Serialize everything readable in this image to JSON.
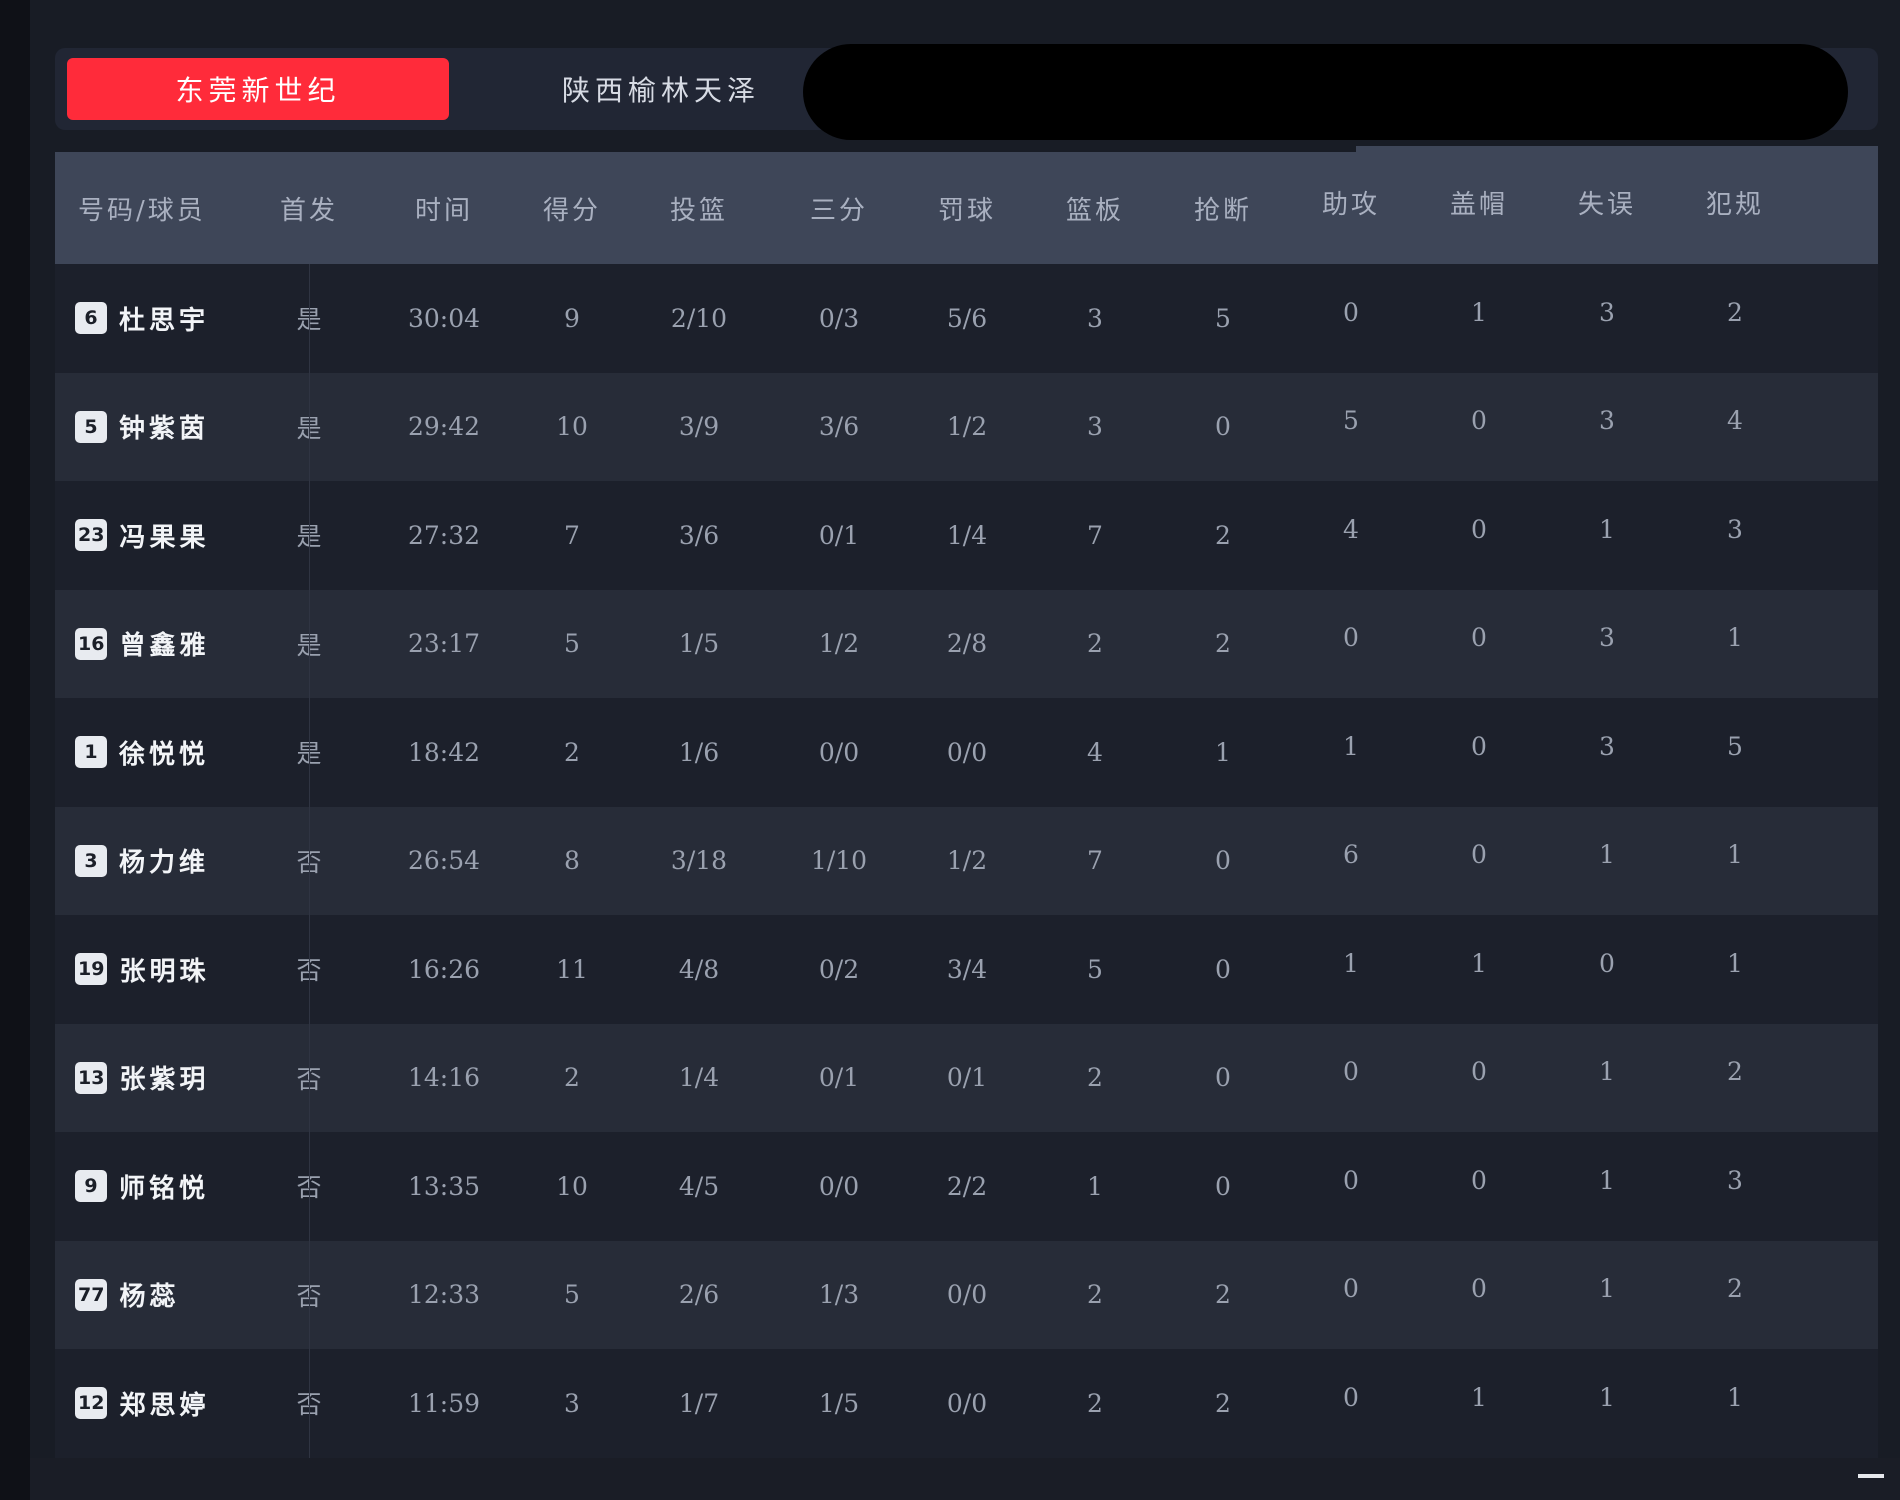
{
  "tabs": [
    {
      "label": "东莞新世纪",
      "active": true
    },
    {
      "label": "陕西榆林天泽",
      "active": false
    }
  ],
  "colors": {
    "accent": "#ff2b3a",
    "header_bg": "#3e4658",
    "row_dark": "#1c202b",
    "row_light": "#272c38"
  },
  "table": {
    "headers": [
      "号码/球员",
      "首发",
      "时间",
      "得分",
      "投篮",
      "三分",
      "罚球",
      "篮板",
      "抢断",
      "助攻",
      "盖帽",
      "失误",
      "犯规"
    ],
    "rows": [
      {
        "number": "6",
        "name": "杜思宇",
        "starter": "是",
        "time": "30:04",
        "pts": "9",
        "fg": "2/10",
        "three": "0/3",
        "ft": "5/6",
        "reb": "3",
        "stl": "5",
        "ast": "0",
        "blk": "1",
        "tov": "3",
        "pf": "2"
      },
      {
        "number": "5",
        "name": "钟紫茵",
        "starter": "是",
        "time": "29:42",
        "pts": "10",
        "fg": "3/9",
        "three": "3/6",
        "ft": "1/2",
        "reb": "3",
        "stl": "0",
        "ast": "5",
        "blk": "0",
        "tov": "3",
        "pf": "4"
      },
      {
        "number": "23",
        "name": "冯果果",
        "starter": "是",
        "time": "27:32",
        "pts": "7",
        "fg": "3/6",
        "three": "0/1",
        "ft": "1/4",
        "reb": "7",
        "stl": "2",
        "ast": "4",
        "blk": "0",
        "tov": "1",
        "pf": "3"
      },
      {
        "number": "16",
        "name": "曾鑫雅",
        "starter": "是",
        "time": "23:17",
        "pts": "5",
        "fg": "1/5",
        "three": "1/2",
        "ft": "2/8",
        "reb": "2",
        "stl": "2",
        "ast": "0",
        "blk": "0",
        "tov": "3",
        "pf": "1"
      },
      {
        "number": "1",
        "name": "徐悦悦",
        "starter": "是",
        "time": "18:42",
        "pts": "2",
        "fg": "1/6",
        "three": "0/0",
        "ft": "0/0",
        "reb": "4",
        "stl": "1",
        "ast": "1",
        "blk": "0",
        "tov": "3",
        "pf": "5"
      },
      {
        "number": "3",
        "name": "杨力维",
        "starter": "否",
        "time": "26:54",
        "pts": "8",
        "fg": "3/18",
        "three": "1/10",
        "ft": "1/2",
        "reb": "7",
        "stl": "0",
        "ast": "6",
        "blk": "0",
        "tov": "1",
        "pf": "1"
      },
      {
        "number": "19",
        "name": "张明珠",
        "starter": "否",
        "time": "16:26",
        "pts": "11",
        "fg": "4/8",
        "three": "0/2",
        "ft": "3/4",
        "reb": "5",
        "stl": "0",
        "ast": "1",
        "blk": "1",
        "tov": "0",
        "pf": "1"
      },
      {
        "number": "13",
        "name": "张紫玥",
        "starter": "否",
        "time": "14:16",
        "pts": "2",
        "fg": "1/4",
        "three": "0/1",
        "ft": "0/1",
        "reb": "2",
        "stl": "0",
        "ast": "0",
        "blk": "0",
        "tov": "1",
        "pf": "2"
      },
      {
        "number": "9",
        "name": "师铭悦",
        "starter": "否",
        "time": "13:35",
        "pts": "10",
        "fg": "4/5",
        "three": "0/0",
        "ft": "2/2",
        "reb": "1",
        "stl": "0",
        "ast": "0",
        "blk": "0",
        "tov": "1",
        "pf": "3"
      },
      {
        "number": "77",
        "name": "杨蕊",
        "starter": "否",
        "time": "12:33",
        "pts": "5",
        "fg": "2/6",
        "three": "1/3",
        "ft": "0/0",
        "reb": "2",
        "stl": "2",
        "ast": "0",
        "blk": "0",
        "tov": "1",
        "pf": "2"
      },
      {
        "number": "12",
        "name": "郑思婷",
        "starter": "否",
        "time": "11:59",
        "pts": "3",
        "fg": "1/7",
        "three": "1/5",
        "ft": "0/0",
        "reb": "2",
        "stl": "2",
        "ast": "0",
        "blk": "1",
        "tov": "1",
        "pf": "1"
      }
    ]
  }
}
